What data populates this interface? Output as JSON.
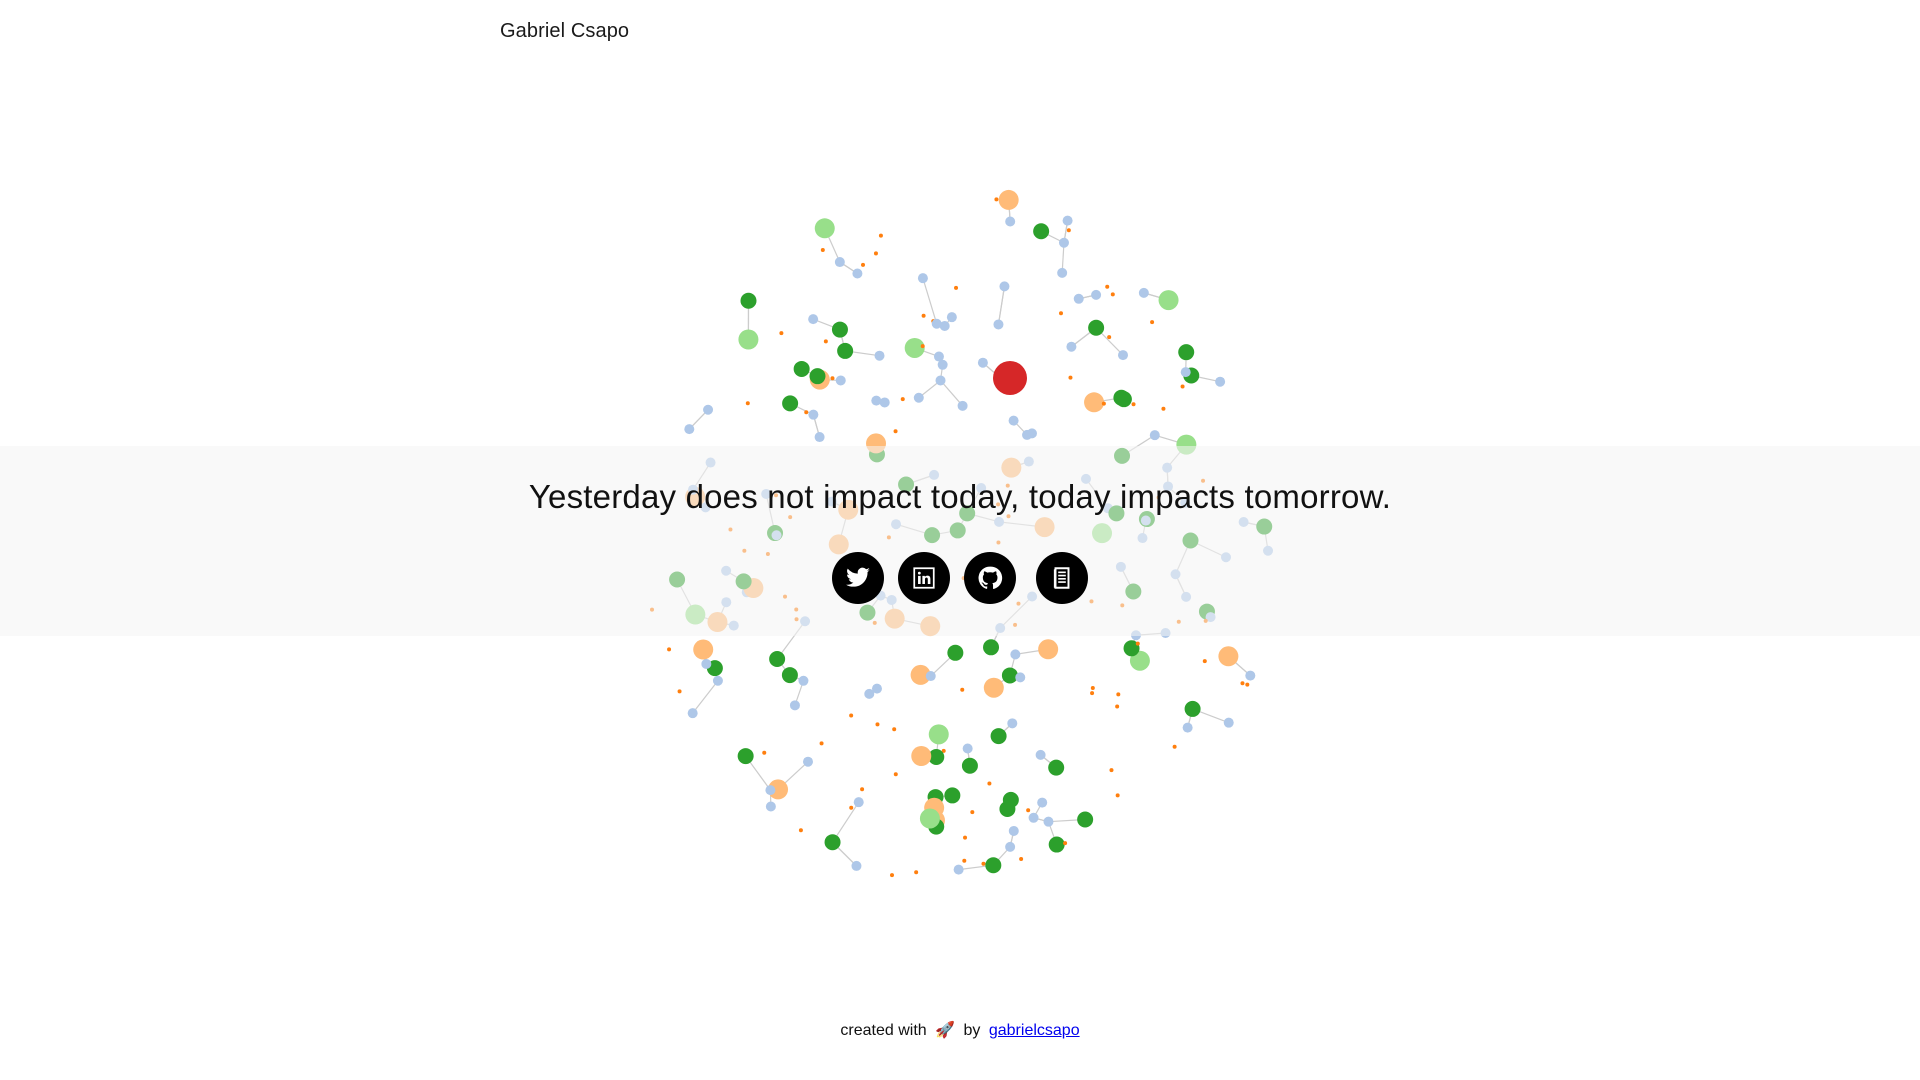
{
  "header": {
    "site_name": "Gabriel Csapo"
  },
  "hero": {
    "quote": "Yesterday does not impact today, today impacts tomorrow."
  },
  "socials": [
    {
      "name": "twitter",
      "icon": "twitter-icon"
    },
    {
      "name": "linkedin",
      "icon": "linkedin-icon"
    },
    {
      "name": "github",
      "icon": "github-icon"
    },
    {
      "name": "writing",
      "icon": "book-icon"
    }
  ],
  "footer": {
    "prefix": "created with",
    "emoji": "🚀",
    "by": "by",
    "link_text": "gabrielcsapo"
  },
  "colors": {
    "node_blue": "#aec7e8",
    "node_orange_dot": "#ff7f0e",
    "node_orange": "#ffbb78",
    "node_green": "#2ca02c",
    "node_light_green": "#98df8a",
    "node_red": "#d62728",
    "link": "#cccccc"
  }
}
